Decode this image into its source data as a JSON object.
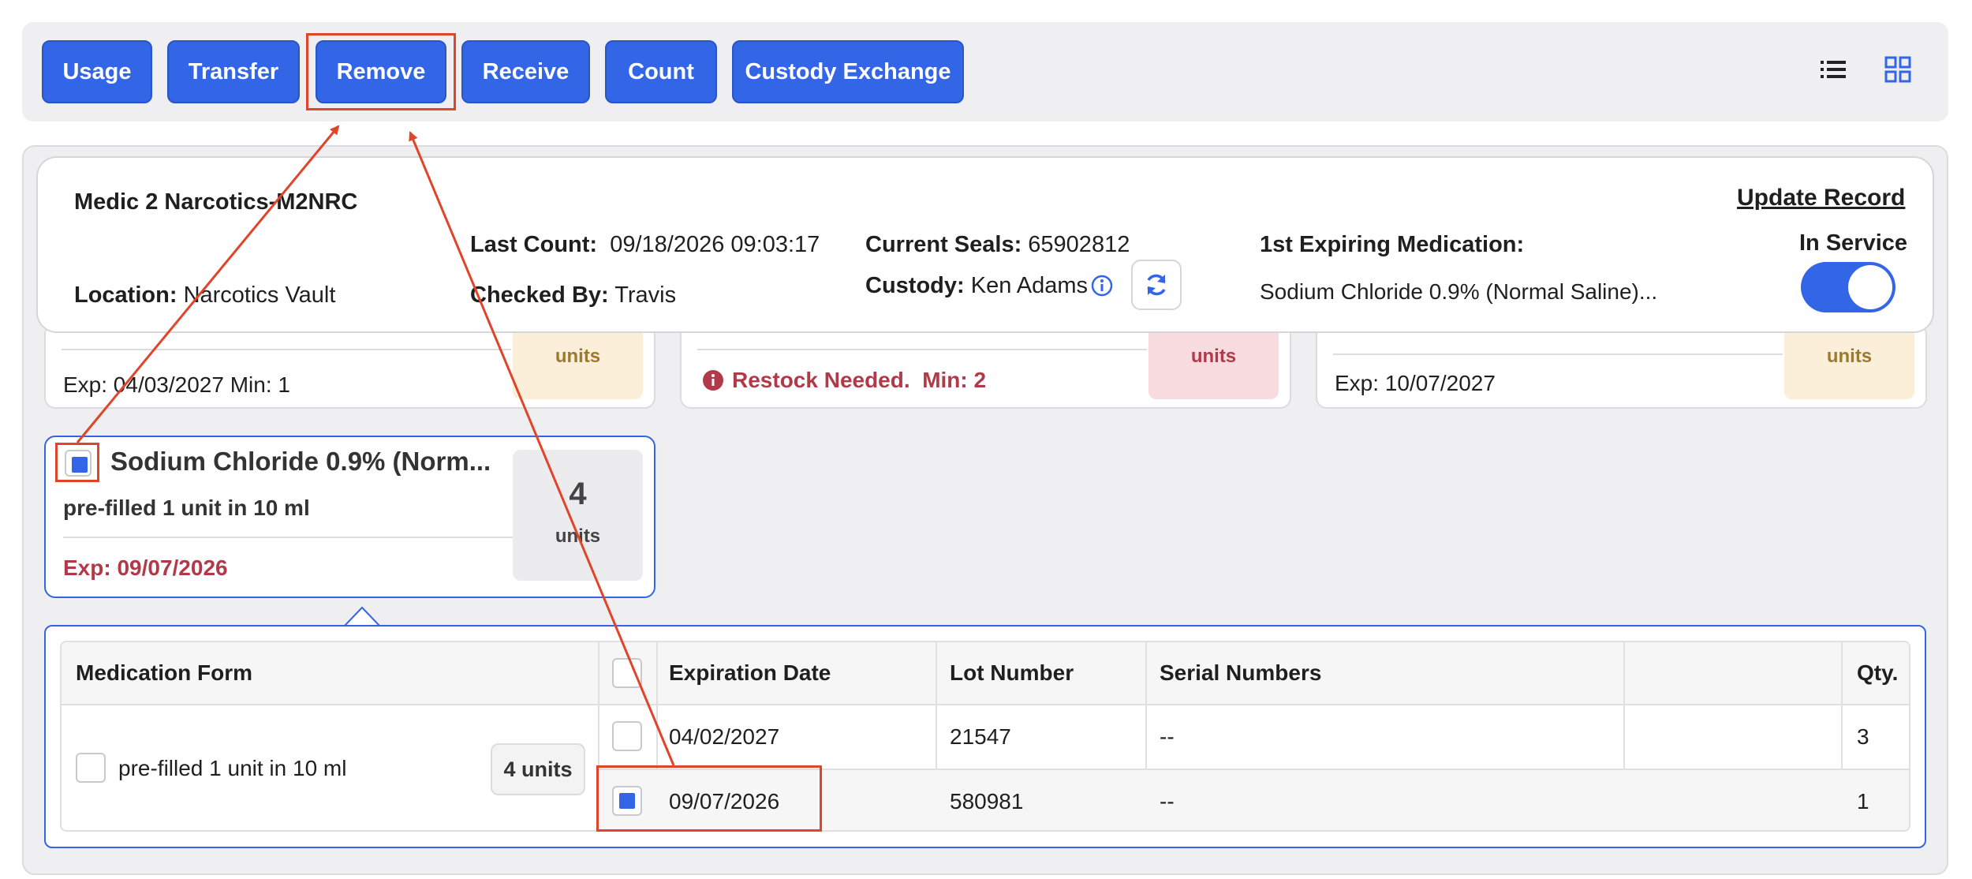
{
  "toolbar": {
    "buttons": [
      "Usage",
      "Transfer",
      "Remove",
      "Receive",
      "Count",
      "Custody Exchange"
    ],
    "list_view_icon": "list-icon",
    "grid_view_icon": "grid-icon"
  },
  "header": {
    "title": "Medic 2 Narcotics-M2NRC",
    "update_record": "Update Record",
    "location_label": "Location:",
    "location_value": "Narcotics Vault",
    "last_count_label": "Last Count:",
    "last_count_value": "09/18/2026 09:03:17",
    "checked_by_label": "Checked By:",
    "checked_by_value": "Travis",
    "seals_label": "Current Seals:",
    "seals_value": "65902812",
    "custody_label": "Custody:",
    "custody_value": "Ken Adams",
    "first_expiring_label": "1st Expiring Medication:",
    "first_expiring_value": "Sodium Chloride 0.9% (Normal Saline)...",
    "in_service_label": "In Service",
    "in_service_on": true
  },
  "cards_row": [
    {
      "exp": "Exp: 04/03/2027 Min: 1",
      "units_label": "units"
    },
    {
      "alert": "Restock Needed.",
      "min": "Min: 2",
      "units_label": "units"
    },
    {
      "exp": "Exp: 10/07/2027",
      "units_label": "units"
    }
  ],
  "selected_card": {
    "title": "Sodium Chloride 0.9% (Norm...",
    "subtitle": "pre-filled 1 unit in 10 ml",
    "exp": "Exp: 09/07/2026",
    "qty": "4",
    "units_label": "units",
    "checked": true
  },
  "detail_table": {
    "headers": {
      "form": "Medication Form",
      "expiration": "Expiration Date",
      "lot": "Lot Number",
      "serial": "Serial Numbers",
      "qty": "Qty."
    },
    "form_value": "pre-filled 1 unit in 10 ml",
    "form_units": "4 units",
    "rows": [
      {
        "expiration": "04/02/2027",
        "lot": "21547",
        "serial": "--",
        "qty": "3",
        "checked": false
      },
      {
        "expiration": "09/07/2026",
        "lot": "580981",
        "serial": "--",
        "qty": "1",
        "checked": true
      }
    ]
  },
  "colors": {
    "primary": "#3366e6",
    "alert": "#b03a48",
    "annotation": "#e0442a"
  }
}
